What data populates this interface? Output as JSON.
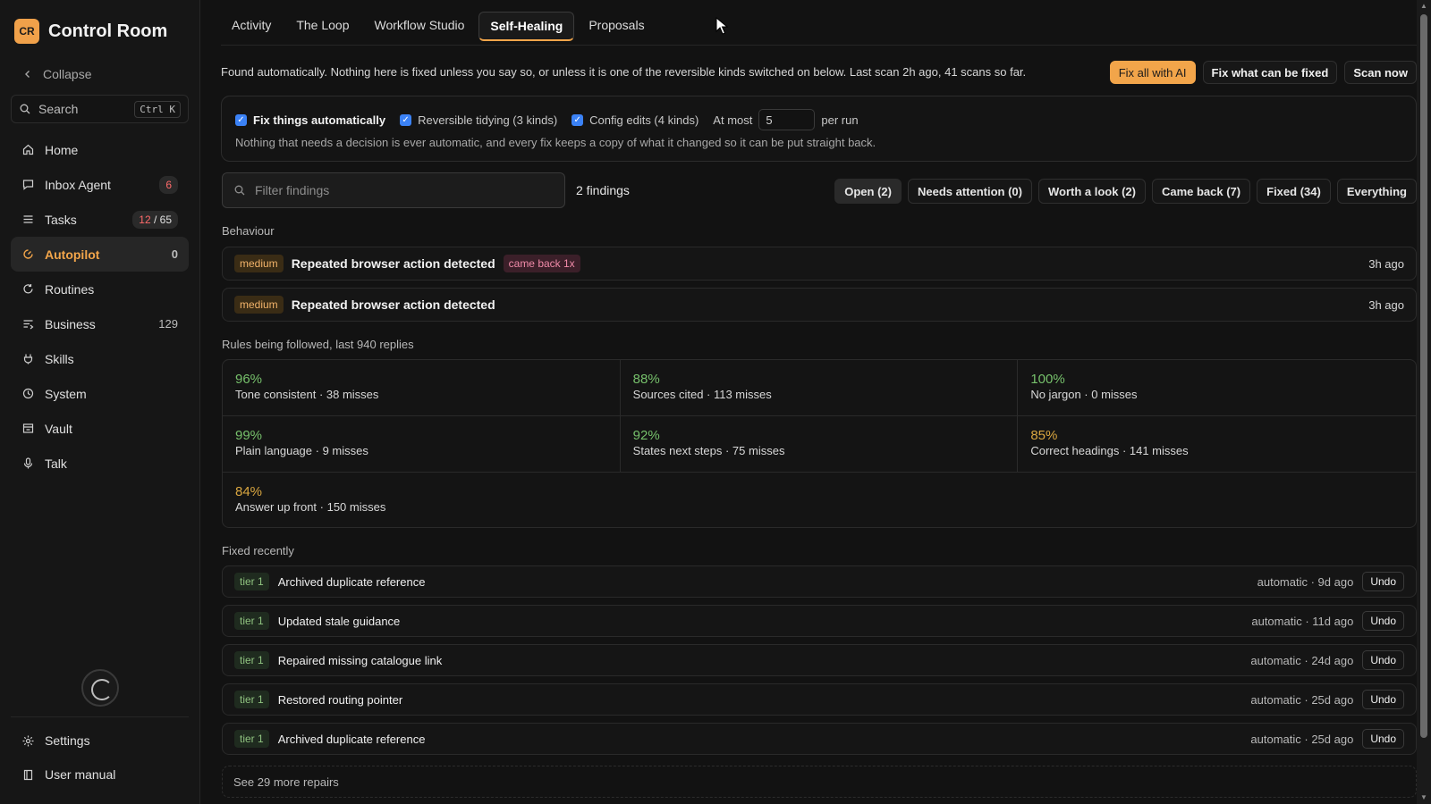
{
  "app": {
    "logo": "CR",
    "name": "Control Room",
    "collapse": "Collapse"
  },
  "search": {
    "label": "Search",
    "shortcut": "Ctrl K"
  },
  "sidebar": {
    "items": [
      {
        "label": "Home",
        "icon": "home-icon"
      },
      {
        "label": "Inbox Agent",
        "icon": "inbox-icon",
        "badge": "6"
      },
      {
        "label": "Tasks",
        "icon": "list-icon",
        "badge_a": "12",
        "badge_b": " / 65"
      },
      {
        "label": "Autopilot",
        "icon": "autopilot-icon",
        "count": "0"
      },
      {
        "label": "Routines",
        "icon": "refresh-icon"
      },
      {
        "label": "Business",
        "icon": "business-icon",
        "count": "129"
      },
      {
        "label": "Skills",
        "icon": "skills-icon"
      },
      {
        "label": "System",
        "icon": "clock-icon"
      },
      {
        "label": "Vault",
        "icon": "vault-icon"
      },
      {
        "label": "Talk",
        "icon": "mic-icon"
      }
    ],
    "bottom": [
      {
        "label": "Settings",
        "icon": "gear-icon"
      },
      {
        "label": "User manual",
        "icon": "book-icon"
      }
    ]
  },
  "tabs": [
    "Activity",
    "The Loop",
    "Workflow Studio",
    "Self-Healing",
    "Proposals"
  ],
  "info_text": "Found automatically. Nothing here is fixed unless you say so, or unless it is one of the reversible kinds switched on below. Last scan 2h ago, 41 scans so far.",
  "actions": {
    "fix_ai": "Fix all with AI",
    "fix_possible": "Fix what can be fixed",
    "scan": "Scan now"
  },
  "auto": {
    "fix_auto": "Fix things automatically",
    "tidying": "Reversible tidying (3 kinds)",
    "config": "Config edits (4 kinds)",
    "at_most": "At most",
    "at_most_value": "5",
    "per_run": "per run",
    "note": "Nothing that needs a decision is ever automatic, and every fix keeps a copy of what it changed so it can be put straight back."
  },
  "filter": {
    "placeholder": "Filter findings",
    "count": "2 findings"
  },
  "chips": [
    "Open (2)",
    "Needs attention (0)",
    "Worth a look (2)",
    "Came back (7)",
    "Fixed (34)",
    "Everything"
  ],
  "behaviour": {
    "label": "Behaviour",
    "findings": [
      {
        "severity": "medium",
        "title": "Repeated browser action detected",
        "tag": "came back 1x",
        "time": "3h ago"
      },
      {
        "severity": "medium",
        "title": "Repeated browser action detected",
        "time": "3h ago"
      }
    ]
  },
  "rules": {
    "label": "Rules being followed, last 940 replies",
    "items": [
      {
        "pct": "96%",
        "desc": "Tone consistent · 38 misses"
      },
      {
        "pct": "88%",
        "desc": "Sources cited · 113 misses"
      },
      {
        "pct": "100%",
        "desc": "No jargon · 0 misses"
      },
      {
        "pct": "99%",
        "desc": "Plain language · 9 misses"
      },
      {
        "pct": "92%",
        "desc": "States next steps · 75 misses"
      },
      {
        "pct": "85%",
        "desc": "Correct headings · 141 misses"
      },
      {
        "pct": "84%",
        "desc": "Answer up front · 150 misses"
      }
    ],
    "colors": {
      "good": "#76c06b",
      "warn": "#d9a640"
    }
  },
  "fixed": {
    "label": "Fixed recently",
    "undo": "Undo",
    "items": [
      {
        "tier": "tier 1",
        "title": "Archived duplicate reference",
        "meta": "automatic · 9d ago"
      },
      {
        "tier": "tier 1",
        "title": "Updated stale guidance",
        "meta": "automatic · 11d ago"
      },
      {
        "tier": "tier 1",
        "title": "Repaired missing catalogue link",
        "meta": "automatic · 24d ago"
      },
      {
        "tier": "tier 1",
        "title": "Restored routing pointer",
        "meta": "automatic · 25d ago"
      },
      {
        "tier": "tier 1",
        "title": "Archived duplicate reference",
        "meta": "automatic · 25d ago"
      }
    ],
    "more": "See 29 more repairs"
  },
  "colors": {
    "accent": "#f2a54a",
    "checkbox": "#3b82f6",
    "background": "#121212"
  }
}
